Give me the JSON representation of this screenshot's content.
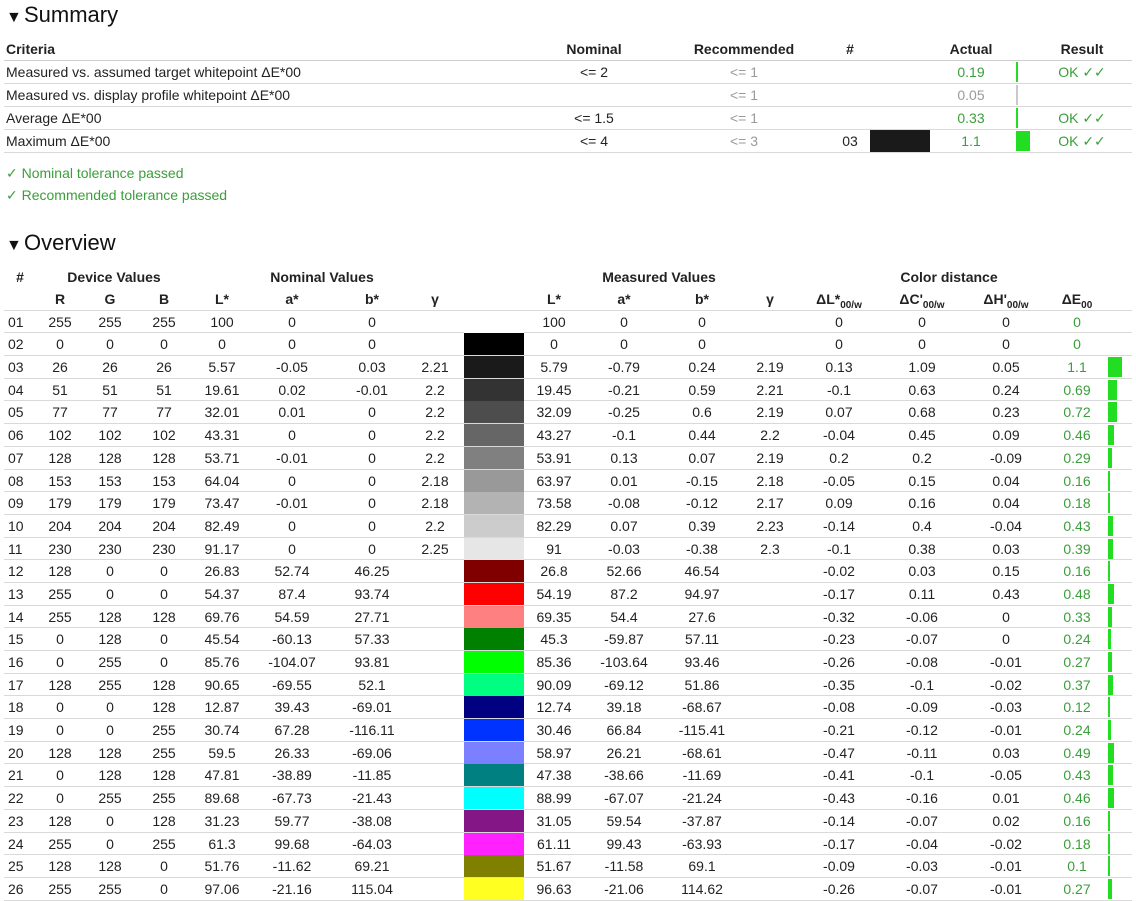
{
  "summary": {
    "title": "Summary",
    "headers": {
      "criteria": "Criteria",
      "nominal": "Nominal",
      "recommended": "Recommended",
      "hash": "#",
      "actual": "Actual",
      "result": "Result"
    },
    "rows": [
      {
        "criteria": "Measured vs. assumed target whitepoint ΔE*00",
        "nominal": "<= 2",
        "recommended": "<= 1",
        "hash": "",
        "swatch": "",
        "actual": "0.19",
        "bar_pct": 2,
        "result": "OK ✓✓",
        "actual_grey": false
      },
      {
        "criteria": "Measured vs. display profile whitepoint ΔE*00",
        "nominal": "",
        "recommended": "<= 1",
        "hash": "",
        "swatch": "",
        "actual": "0.05",
        "bar_pct": 1,
        "result": "",
        "actual_grey": true
      },
      {
        "criteria": "Average ΔE*00",
        "nominal": "<= 1.5",
        "recommended": "<= 1",
        "hash": "",
        "swatch": "",
        "actual": "0.33",
        "bar_pct": 0,
        "result": "OK ✓✓",
        "actual_grey": false
      },
      {
        "criteria": "Maximum ΔE*00",
        "nominal": "<= 4",
        "recommended": "<= 3",
        "hash": "03",
        "swatch": "#1a1a1a",
        "actual": "1.1",
        "bar_pct": 100,
        "result": "OK ✓✓",
        "actual_grey": false
      }
    ],
    "pass_messages": [
      "✓ Nominal tolerance passed",
      "✓ Recommended tolerance passed"
    ]
  },
  "overview": {
    "title": "Overview",
    "groups": {
      "hash": "#",
      "device": "Device Values",
      "nominal": "Nominal Values",
      "measured": "Measured Values",
      "distance": "Color distance"
    },
    "headers": [
      "R",
      "G",
      "B",
      "L*",
      "a*",
      "b*",
      "γ",
      "L*",
      "a*",
      "b*",
      "γ",
      "ΔL*00/w",
      "ΔC'00/w",
      "ΔH'00/w",
      "ΔE00"
    ],
    "rows": [
      {
        "id": "01",
        "rgb": [
          "255",
          "255",
          "255"
        ],
        "nom": [
          "100",
          "0",
          "0",
          ""
        ],
        "color": "#ffffff",
        "meas": [
          "100",
          "0",
          "0",
          ""
        ],
        "dist": [
          "0",
          "0",
          "0",
          "0"
        ],
        "bar": 0
      },
      {
        "id": "02",
        "rgb": [
          "0",
          "0",
          "0"
        ],
        "nom": [
          "0",
          "0",
          "0",
          ""
        ],
        "color": "#000000",
        "meas": [
          "0",
          "0",
          "0",
          ""
        ],
        "dist": [
          "0",
          "0",
          "0",
          "0"
        ],
        "bar": 0
      },
      {
        "id": "03",
        "rgb": [
          "26",
          "26",
          "26"
        ],
        "nom": [
          "5.57",
          "-0.05",
          "0.03",
          "2.21"
        ],
        "color": "#1a1a1a",
        "meas": [
          "5.79",
          "-0.79",
          "0.24",
          "2.19"
        ],
        "dist": [
          "0.13",
          "1.09",
          "0.05",
          "1.1"
        ],
        "bar": 100
      },
      {
        "id": "04",
        "rgb": [
          "51",
          "51",
          "51"
        ],
        "nom": [
          "19.61",
          "0.02",
          "-0.01",
          "2.2"
        ],
        "color": "#333333",
        "meas": [
          "19.45",
          "-0.21",
          "0.59",
          "2.21"
        ],
        "dist": [
          "-0.1",
          "0.63",
          "0.24",
          "0.69"
        ],
        "bar": 63
      },
      {
        "id": "05",
        "rgb": [
          "77",
          "77",
          "77"
        ],
        "nom": [
          "32.01",
          "0.01",
          "0",
          "2.2"
        ],
        "color": "#4d4d4d",
        "meas": [
          "32.09",
          "-0.25",
          "0.6",
          "2.19"
        ],
        "dist": [
          "0.07",
          "0.68",
          "0.23",
          "0.72"
        ],
        "bar": 65
      },
      {
        "id": "06",
        "rgb": [
          "102",
          "102",
          "102"
        ],
        "nom": [
          "43.31",
          "0",
          "0",
          "2.2"
        ],
        "color": "#666666",
        "meas": [
          "43.27",
          "-0.1",
          "0.44",
          "2.2"
        ],
        "dist": [
          "-0.04",
          "0.45",
          "0.09",
          "0.46"
        ],
        "bar": 42
      },
      {
        "id": "07",
        "rgb": [
          "128",
          "128",
          "128"
        ],
        "nom": [
          "53.71",
          "-0.01",
          "0",
          "2.2"
        ],
        "color": "#808080",
        "meas": [
          "53.91",
          "0.13",
          "0.07",
          "2.19"
        ],
        "dist": [
          "0.2",
          "0.2",
          "-0.09",
          "0.29"
        ],
        "bar": 26
      },
      {
        "id": "08",
        "rgb": [
          "153",
          "153",
          "153"
        ],
        "nom": [
          "64.04",
          "0",
          "0",
          "2.18"
        ],
        "color": "#999999",
        "meas": [
          "63.97",
          "0.01",
          "-0.15",
          "2.18"
        ],
        "dist": [
          "-0.05",
          "0.15",
          "0.04",
          "0.16"
        ],
        "bar": 15
      },
      {
        "id": "09",
        "rgb": [
          "179",
          "179",
          "179"
        ],
        "nom": [
          "73.47",
          "-0.01",
          "0",
          "2.18"
        ],
        "color": "#b3b3b3",
        "meas": [
          "73.58",
          "-0.08",
          "-0.12",
          "2.17"
        ],
        "dist": [
          "0.09",
          "0.16",
          "0.04",
          "0.18"
        ],
        "bar": 16
      },
      {
        "id": "10",
        "rgb": [
          "204",
          "204",
          "204"
        ],
        "nom": [
          "82.49",
          "0",
          "0",
          "2.2"
        ],
        "color": "#cccccc",
        "meas": [
          "82.29",
          "0.07",
          "0.39",
          "2.23"
        ],
        "dist": [
          "-0.14",
          "0.4",
          "-0.04",
          "0.43"
        ],
        "bar": 39
      },
      {
        "id": "11",
        "rgb": [
          "230",
          "230",
          "230"
        ],
        "nom": [
          "91.17",
          "0",
          "0",
          "2.25"
        ],
        "color": "#e6e6e6",
        "meas": [
          "91",
          "-0.03",
          "-0.38",
          "2.3"
        ],
        "dist": [
          "-0.1",
          "0.38",
          "0.03",
          "0.39"
        ],
        "bar": 35
      },
      {
        "id": "12",
        "rgb": [
          "128",
          "0",
          "0"
        ],
        "nom": [
          "26.83",
          "52.74",
          "46.25",
          ""
        ],
        "color": "#800000",
        "meas": [
          "26.8",
          "52.66",
          "46.54",
          ""
        ],
        "dist": [
          "-0.02",
          "0.03",
          "0.15",
          "0.16"
        ],
        "bar": 15
      },
      {
        "id": "13",
        "rgb": [
          "255",
          "0",
          "0"
        ],
        "nom": [
          "54.37",
          "87.4",
          "93.74",
          ""
        ],
        "color": "#ff0000",
        "meas": [
          "54.19",
          "87.2",
          "94.97",
          ""
        ],
        "dist": [
          "-0.17",
          "0.11",
          "0.43",
          "0.48"
        ],
        "bar": 44
      },
      {
        "id": "14",
        "rgb": [
          "255",
          "128",
          "128"
        ],
        "nom": [
          "69.76",
          "54.59",
          "27.71",
          ""
        ],
        "color": "#ff8080",
        "meas": [
          "69.35",
          "54.4",
          "27.6",
          ""
        ],
        "dist": [
          "-0.32",
          "-0.06",
          "0",
          "0.33"
        ],
        "bar": 30
      },
      {
        "id": "15",
        "rgb": [
          "0",
          "128",
          "0"
        ],
        "nom": [
          "45.54",
          "-60.13",
          "57.33",
          ""
        ],
        "color": "#008000",
        "meas": [
          "45.3",
          "-59.87",
          "57.11",
          ""
        ],
        "dist": [
          "-0.23",
          "-0.07",
          "0",
          "0.24"
        ],
        "bar": 22
      },
      {
        "id": "16",
        "rgb": [
          "0",
          "255",
          "0"
        ],
        "nom": [
          "85.76",
          "-104.07",
          "93.81",
          ""
        ],
        "color": "#00ff00",
        "meas": [
          "85.36",
          "-103.64",
          "93.46",
          ""
        ],
        "dist": [
          "-0.26",
          "-0.08",
          "-0.01",
          "0.27"
        ],
        "bar": 25
      },
      {
        "id": "17",
        "rgb": [
          "128",
          "255",
          "128"
        ],
        "nom": [
          "90.65",
          "-69.55",
          "52.1",
          ""
        ],
        "color": "#00ff80",
        "meas": [
          "90.09",
          "-69.12",
          "51.86",
          ""
        ],
        "dist": [
          "-0.35",
          "-0.1",
          "-0.02",
          "0.37"
        ],
        "bar": 34
      },
      {
        "id": "18",
        "rgb": [
          "0",
          "0",
          "128"
        ],
        "nom": [
          "12.87",
          "39.43",
          "-69.01",
          ""
        ],
        "color": "#000080",
        "meas": [
          "12.74",
          "39.18",
          "-68.67",
          ""
        ],
        "dist": [
          "-0.08",
          "-0.09",
          "-0.03",
          "0.12"
        ],
        "bar": 11
      },
      {
        "id": "19",
        "rgb": [
          "0",
          "0",
          "255"
        ],
        "nom": [
          "30.74",
          "67.28",
          "-116.11",
          ""
        ],
        "color": "#0033ff",
        "meas": [
          "30.46",
          "66.84",
          "-115.41",
          ""
        ],
        "dist": [
          "-0.21",
          "-0.12",
          "-0.01",
          "0.24"
        ],
        "bar": 22
      },
      {
        "id": "20",
        "rgb": [
          "128",
          "128",
          "255"
        ],
        "nom": [
          "59.5",
          "26.33",
          "-69.06",
          ""
        ],
        "color": "#7a80ff",
        "meas": [
          "58.97",
          "26.21",
          "-68.61",
          ""
        ],
        "dist": [
          "-0.47",
          "-0.11",
          "0.03",
          "0.49"
        ],
        "bar": 45
      },
      {
        "id": "21",
        "rgb": [
          "0",
          "128",
          "128"
        ],
        "nom": [
          "47.81",
          "-38.89",
          "-11.85",
          ""
        ],
        "color": "#008080",
        "meas": [
          "47.38",
          "-38.66",
          "-11.69",
          ""
        ],
        "dist": [
          "-0.41",
          "-0.1",
          "-0.05",
          "0.43"
        ],
        "bar": 39
      },
      {
        "id": "22",
        "rgb": [
          "0",
          "255",
          "255"
        ],
        "nom": [
          "89.68",
          "-67.73",
          "-21.43",
          ""
        ],
        "color": "#00ffff",
        "meas": [
          "88.99",
          "-67.07",
          "-21.24",
          ""
        ],
        "dist": [
          "-0.43",
          "-0.16",
          "0.01",
          "0.46"
        ],
        "bar": 42
      },
      {
        "id": "23",
        "rgb": [
          "128",
          "0",
          "128"
        ],
        "nom": [
          "31.23",
          "59.77",
          "-38.08",
          ""
        ],
        "color": "#851685",
        "meas": [
          "31.05",
          "59.54",
          "-37.87",
          ""
        ],
        "dist": [
          "-0.14",
          "-0.07",
          "0.02",
          "0.16"
        ],
        "bar": 15
      },
      {
        "id": "24",
        "rgb": [
          "255",
          "0",
          "255"
        ],
        "nom": [
          "61.3",
          "99.68",
          "-64.03",
          ""
        ],
        "color": "#ff22ff",
        "meas": [
          "61.11",
          "99.43",
          "-63.93",
          ""
        ],
        "dist": [
          "-0.17",
          "-0.04",
          "-0.02",
          "0.18"
        ],
        "bar": 16
      },
      {
        "id": "25",
        "rgb": [
          "128",
          "128",
          "0"
        ],
        "nom": [
          "51.76",
          "-11.62",
          "69.21",
          ""
        ],
        "color": "#808000",
        "meas": [
          "51.67",
          "-11.58",
          "69.1",
          ""
        ],
        "dist": [
          "-0.09",
          "-0.03",
          "-0.01",
          "0.1"
        ],
        "bar": 9
      },
      {
        "id": "26",
        "rgb": [
          "255",
          "255",
          "0"
        ],
        "nom": [
          "97.06",
          "-21.16",
          "115.04",
          ""
        ],
        "color": "#ffff22",
        "meas": [
          "96.63",
          "-21.06",
          "114.62",
          ""
        ],
        "dist": [
          "-0.26",
          "-0.07",
          "-0.01",
          "0.27"
        ],
        "bar": 25
      }
    ]
  }
}
